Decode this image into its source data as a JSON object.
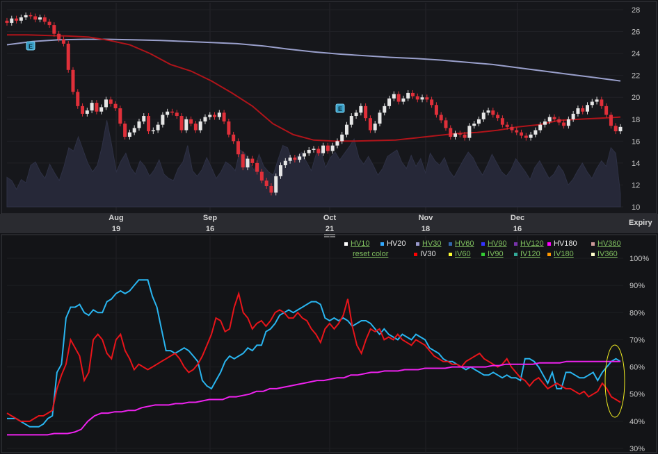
{
  "chart_data": [
    {
      "type": "candlestick",
      "title": "",
      "y_ticks": [
        28,
        26,
        24,
        22,
        20,
        18,
        16,
        14,
        12,
        10
      ],
      "ylim": [
        10,
        28
      ],
      "x_labels": [
        {
          "month": "Aug",
          "day": "19"
        },
        {
          "month": "Sep",
          "day": "16"
        },
        {
          "month": "Oct",
          "day": "21"
        },
        {
          "month": "Nov",
          "day": "18"
        },
        {
          "month": "Dec",
          "day": "16"
        }
      ],
      "expiry_label": "Expiry",
      "earnings_marker": "E",
      "grid": true,
      "series": [
        {
          "name": "Price",
          "kind": "candles",
          "up_color": "#e6e6e6",
          "down_color": "#e0303a",
          "close": [
            26.8,
            27.2,
            27.0,
            27.3,
            27.5,
            27.4,
            27.1,
            27.3,
            26.9,
            26.6,
            25.8,
            25.3,
            24.9,
            22.5,
            20.5,
            19.2,
            18.5,
            18.8,
            19.5,
            18.7,
            19.1,
            19.8,
            19.4,
            19.0,
            17.6,
            16.4,
            16.8,
            17.2,
            17.8,
            18.3,
            16.9,
            17.0,
            17.5,
            18.4,
            18.7,
            18.6,
            18.3,
            17.0,
            18.0,
            17.6,
            17.0,
            17.8,
            18.2,
            18.4,
            18.2,
            18.6,
            17.8,
            16.6,
            16.0,
            14.8,
            13.6,
            14.4,
            14.0,
            13.2,
            12.4,
            11.9,
            11.3,
            12.8,
            13.8,
            14.2,
            14.5,
            14.3,
            14.6,
            14.9,
            15.2,
            15.3,
            14.9,
            15.6,
            15.1,
            15.6,
            16.0,
            16.6,
            17.5,
            18.3,
            18.6,
            19.2,
            18.1,
            17.0,
            17.6,
            18.6,
            19.2,
            19.9,
            20.3,
            19.6,
            19.9,
            20.4,
            20.1,
            19.8,
            20.0,
            19.8,
            19.3,
            18.4,
            17.9,
            17.2,
            16.4,
            16.7,
            16.6,
            16.3,
            17.4,
            17.6,
            18.0,
            18.6,
            18.8,
            18.4,
            18.1,
            17.5,
            17.3,
            17.0,
            16.8,
            16.5,
            16.3,
            16.6,
            17.0,
            17.5,
            17.8,
            18.2,
            18.0,
            17.7,
            17.4,
            18.0,
            18.5,
            19.0,
            18.7,
            19.3,
            19.6,
            19.8,
            19.2,
            18.4,
            17.4,
            16.9,
            17.3
          ],
          "ma_red": [
            25.7,
            25.7,
            25.65,
            25.6,
            25.5,
            25.2,
            24.8,
            24.0,
            23.0,
            22.4,
            21.5,
            20.4,
            19.2,
            17.6,
            16.6,
            16.1,
            16.0,
            16.0,
            16.05,
            16.1,
            16.3,
            16.5,
            16.7,
            16.8,
            17.0,
            17.3,
            17.5,
            17.9,
            18.0,
            18.1,
            18.2
          ],
          "ma_blue": [
            24.8,
            25.1,
            25.25,
            25.3,
            25.3,
            25.25,
            25.2,
            25.1,
            25.0,
            24.9,
            24.7,
            24.4,
            24.15,
            23.95,
            23.8,
            23.65,
            23.55,
            23.4,
            23.2,
            23.0,
            22.7,
            22.4,
            22.1,
            21.8,
            21.5
          ]
        }
      ]
    },
    {
      "type": "line",
      "title": "",
      "y_ticks": [
        "100%",
        "90%",
        "80%",
        "70%",
        "60%",
        "50%",
        "40%",
        "30%"
      ],
      "ylim": [
        30,
        100
      ],
      "legend_row1": [
        {
          "label": "HV10",
          "color": "#ffffff",
          "link": true
        },
        {
          "label": "HV20",
          "color": "#33aaff",
          "link": false
        },
        {
          "label": "HV30",
          "color": "#9999cc",
          "link": true
        },
        {
          "label": "HV60",
          "color": "#3366aa",
          "link": true
        },
        {
          "label": "HV90",
          "color": "#3333ff",
          "link": true
        },
        {
          "label": "HV120",
          "color": "#7733aa",
          "link": true
        },
        {
          "label": "HV180",
          "color": "#ff00ff",
          "link": false
        },
        {
          "label": "HV360",
          "color": "#cc9999",
          "link": true
        }
      ],
      "legend_row2": [
        {
          "label": "reset color",
          "color": "",
          "link": true
        },
        {
          "label": "IV30",
          "color": "#ff0000",
          "link": false
        },
        {
          "label": "IV60",
          "color": "#ffff33",
          "link": true
        },
        {
          "label": "IV90",
          "color": "#33cc33",
          "link": true
        },
        {
          "label": "IV120",
          "color": "#33aa99",
          "link": true
        },
        {
          "label": "IV180",
          "color": "#ff9900",
          "link": true
        },
        {
          "label": "IV360",
          "color": "#ffffcc",
          "link": true
        }
      ],
      "series": [
        {
          "name": "HV20",
          "color": "#29b5f0",
          "values": [
            41,
            41,
            41,
            40,
            39,
            38,
            38,
            38,
            39,
            41,
            42,
            58,
            61,
            78,
            82,
            82,
            83,
            80,
            79,
            81,
            80,
            80,
            84,
            85,
            87,
            88,
            87,
            88,
            90,
            92,
            92,
            92,
            86,
            82,
            74,
            66,
            66,
            65,
            66,
            67,
            66,
            64,
            62,
            55,
            53,
            52,
            55,
            58,
            62,
            64,
            63,
            64,
            65,
            67,
            66,
            68,
            68,
            73,
            74,
            76,
            79,
            80,
            81,
            80,
            81,
            82,
            83,
            84,
            84,
            83,
            78,
            77,
            78,
            77,
            78,
            77,
            75,
            76,
            77,
            77,
            76,
            74,
            72,
            74,
            72,
            71,
            70,
            72,
            71,
            70,
            72,
            71,
            70,
            67,
            66,
            65,
            63,
            62,
            62,
            61,
            60,
            59,
            60,
            59,
            58,
            57,
            57,
            58,
            57,
            56,
            57,
            56,
            56,
            55,
            63,
            63,
            62,
            60,
            57,
            54,
            58,
            52,
            52,
            58,
            58,
            57,
            56,
            56,
            57,
            58,
            55,
            58,
            60,
            62,
            63,
            62
          ]
        },
        {
          "name": "IV30",
          "color": "#e8141a",
          "values": [
            43,
            42,
            41,
            40,
            40,
            40,
            41,
            42,
            42,
            43,
            44,
            52,
            57,
            61,
            70,
            67,
            64,
            55,
            58,
            70,
            72,
            70,
            65,
            63,
            70,
            72,
            66,
            63,
            59,
            61,
            60,
            59,
            60,
            61,
            62,
            63,
            64,
            65,
            63,
            60,
            58,
            59,
            61,
            64,
            68,
            72,
            78,
            77,
            73,
            74,
            82,
            87,
            80,
            78,
            74,
            76,
            77,
            75,
            77,
            80,
            81,
            80,
            78,
            78,
            80,
            78,
            77,
            74,
            72,
            69,
            74,
            76,
            74,
            76,
            79,
            85,
            75,
            68,
            65,
            70,
            74,
            73,
            74,
            70,
            71,
            70,
            72,
            70,
            69,
            68,
            70,
            69,
            68,
            66,
            64,
            63,
            62,
            62,
            61,
            61,
            60,
            62,
            63,
            64,
            65,
            63,
            62,
            61,
            60,
            61,
            63,
            60,
            58,
            56,
            55,
            53,
            55,
            56,
            54,
            52,
            53,
            54,
            53,
            52,
            52,
            51,
            50,
            51,
            49,
            50,
            51,
            54,
            52,
            49,
            48,
            47
          ]
        },
        {
          "name": "HV180",
          "color": "#ee22ee",
          "values": [
            35,
            35,
            35,
            35,
            35,
            35,
            35,
            35.5,
            35.5,
            35.5,
            36,
            37,
            40,
            42,
            43,
            43,
            43.5,
            43.5,
            44,
            44,
            45,
            45.5,
            46,
            46,
            46,
            46.5,
            46.5,
            47,
            47,
            47.5,
            48,
            48,
            48,
            49,
            49,
            49.5,
            50,
            51,
            51,
            52,
            52,
            52.5,
            53,
            53.5,
            54,
            54.5,
            55,
            55,
            55.5,
            56,
            56,
            57,
            57,
            57.5,
            58,
            58,
            58.5,
            58.5,
            58.5,
            59,
            59,
            59,
            59.5,
            59.5,
            59.5,
            59.5,
            60,
            60,
            60,
            60,
            60,
            60,
            60.5,
            60.5,
            61,
            61,
            61,
            61,
            61,
            61.5,
            61.5,
            61.5,
            61.5,
            62,
            62,
            62,
            62,
            62,
            62,
            62,
            62,
            62
          ]
        }
      ],
      "highlight_ellipse": true
    }
  ]
}
